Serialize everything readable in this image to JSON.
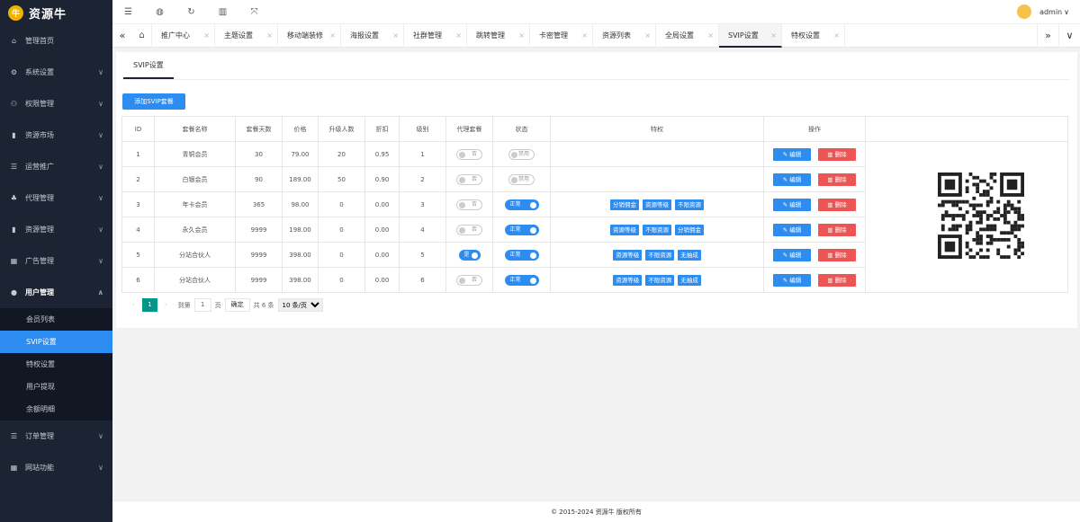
{
  "app": {
    "logo_text": "资源牛",
    "logo_mark": "牛"
  },
  "topbar": {
    "icons": [
      "menu-icon",
      "globe-icon",
      "refresh-icon",
      "trash-icon",
      "fullscreen-icon"
    ],
    "user": "admin"
  },
  "sidebar": {
    "items": [
      {
        "label": "管理首页",
        "icon": "home-icon",
        "glyph": "⌂",
        "chevron": false
      },
      {
        "label": "系统设置",
        "icon": "gear-icon",
        "glyph": "⚙",
        "chevron": true
      },
      {
        "label": "权限管理",
        "icon": "users-icon",
        "glyph": "⚇",
        "chevron": true
      },
      {
        "label": "资源市场",
        "icon": "book-icon",
        "glyph": "▮",
        "chevron": true
      },
      {
        "label": "运营推广",
        "icon": "list-icon",
        "glyph": "☰",
        "chevron": true
      },
      {
        "label": "代理管理",
        "icon": "agent-icon",
        "glyph": "♣",
        "chevron": true
      },
      {
        "label": "资源管理",
        "icon": "file-icon",
        "glyph": "▮",
        "chevron": true
      },
      {
        "label": "广告管理",
        "icon": "ad-icon",
        "glyph": "▦",
        "chevron": true
      },
      {
        "label": "用户管理",
        "icon": "user-icon",
        "glyph": "●",
        "chevron": true,
        "open": true
      },
      {
        "label": "订单管理",
        "icon": "order-icon",
        "glyph": "☰",
        "chevron": true
      },
      {
        "label": "网站功能",
        "icon": "grid-icon",
        "glyph": "▦",
        "chevron": true
      }
    ],
    "sub_items": [
      "会员列表",
      "SVIP设置",
      "特权设置",
      "用户提现",
      "余额明细"
    ],
    "active_sub": 1
  },
  "tabs": [
    "推广中心",
    "主题设置",
    "移动端装修",
    "海报设置",
    "社群管理",
    "跳转管理",
    "卡密管理",
    "资源列表",
    "全局设置",
    "SVIP设置",
    "特权设置"
  ],
  "active_tab": 9,
  "page": {
    "tab_title": "SVIP设置",
    "add_button": "添加SVIP套餐"
  },
  "table": {
    "headers": [
      "ID",
      "套餐名称",
      "套餐天数",
      "价格",
      "升级人数",
      "折扣",
      "级别",
      "代理套餐",
      "状态",
      "特权",
      "操作"
    ],
    "rows": [
      {
        "id": "1",
        "name": "青铜会员",
        "days": "30",
        "price": "79.00",
        "upgrade": "20",
        "discount": "0.95",
        "level": "1",
        "agent": "否",
        "agent_on": false,
        "status": "禁用",
        "status_on": false,
        "perks": []
      },
      {
        "id": "2",
        "name": "白银会员",
        "days": "90",
        "price": "189.00",
        "upgrade": "50",
        "discount": "0.90",
        "level": "2",
        "agent": "否",
        "agent_on": false,
        "status": "禁用",
        "status_on": false,
        "perks": []
      },
      {
        "id": "3",
        "name": "年卡会员",
        "days": "365",
        "price": "98.00",
        "upgrade": "0",
        "discount": "0.00",
        "level": "3",
        "agent": "否",
        "agent_on": false,
        "status": "正常",
        "status_on": true,
        "perks": [
          "分销佣金",
          "资源等级",
          "不限资源"
        ]
      },
      {
        "id": "4",
        "name": "永久会员",
        "days": "9999",
        "price": "198.00",
        "upgrade": "0",
        "discount": "0.00",
        "level": "4",
        "agent": "否",
        "agent_on": false,
        "status": "正常",
        "status_on": true,
        "perks": [
          "资源等级",
          "不限资源",
          "分销佣金"
        ]
      },
      {
        "id": "5",
        "name": "分站合伙人",
        "days": "9999",
        "price": "398.00",
        "upgrade": "0",
        "discount": "0.00",
        "level": "5",
        "agent": "是",
        "agent_on": true,
        "status": "正常",
        "status_on": true,
        "perks": [
          "资源等级",
          "不限资源",
          "无抽成"
        ]
      },
      {
        "id": "6",
        "name": "分站合伙人",
        "days": "9999",
        "price": "398.00",
        "upgrade": "0",
        "discount": "0.00",
        "level": "6",
        "agent": "否",
        "agent_on": false,
        "status": "正常",
        "status_on": true,
        "perks": [
          "资源等级",
          "不限资源",
          "无抽成"
        ]
      }
    ],
    "edit_label": "编辑",
    "delete_label": "删除"
  },
  "pager": {
    "prev": "‹",
    "current": "1",
    "next": "›",
    "goto_label": "到第",
    "goto_value": "1",
    "page_suffix": "页",
    "confirm": "确定",
    "total": "共 6 条",
    "per_page": "10 条/页"
  },
  "footer": "© 2015-2024 资源牛 版权所有",
  "colors": {
    "sidebar": "#1c2434",
    "primary": "#2d8cf0",
    "danger": "#ed5454",
    "pager_active": "#009688"
  }
}
